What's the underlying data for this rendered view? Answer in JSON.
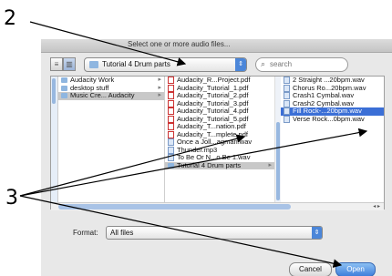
{
  "callouts": {
    "two": "2",
    "three": "3"
  },
  "dialog": {
    "title": "Select one or more audio files...",
    "folder_popup": "Tutorial 4 Drum parts",
    "search_placeholder": "search",
    "format_label": "Format:",
    "format_value": "All files",
    "cancel_label": "Cancel",
    "open_label": "Open"
  },
  "columns": {
    "col1": [
      {
        "label": "Audacity Work",
        "icon": "folder-icon"
      },
      {
        "label": "desktop stuff",
        "icon": "folder-icon"
      },
      {
        "label": "Music Cre... Audacity",
        "icon": "folder-icon"
      }
    ],
    "col2": [
      {
        "label": "Audacity_R...Project.pdf",
        "icon": "pdf-icon"
      },
      {
        "label": "Audacity_Tutorial_1.pdf",
        "icon": "pdf-icon"
      },
      {
        "label": "Audacity_Tutorial_2.pdf",
        "icon": "pdf-icon"
      },
      {
        "label": "Audacity_Tutorial_3.pdf",
        "icon": "pdf-icon"
      },
      {
        "label": "Audacity_Tutorial_4.pdf",
        "icon": "pdf-icon"
      },
      {
        "label": "Audacity_Tutorial_5.pdf",
        "icon": "pdf-icon"
      },
      {
        "label": "Audacity_T...nation.pdf",
        "icon": "pdf-icon"
      },
      {
        "label": "Audacity_T...mplete.pdf",
        "icon": "pdf-icon"
      },
      {
        "label": "Once a Joll...agman.wav",
        "icon": "audio-file-icon"
      },
      {
        "label": "Thunder.mp3",
        "icon": "audio-file-icon"
      },
      {
        "label": "To Be Or N...o Be 1.wav",
        "icon": "audio-file-icon"
      },
      {
        "label": "Tutorial 4 Drum parts",
        "icon": "folder-icon"
      }
    ],
    "col3": [
      {
        "label": "2 Straight ...20bpm.wav",
        "icon": "audio-file-icon"
      },
      {
        "label": "Chorus Ro...20bpm.wav",
        "icon": "audio-file-icon"
      },
      {
        "label": "Crash1 Cymbal.wav",
        "icon": "audio-file-icon"
      },
      {
        "label": "Crash2 Cymbal.wav",
        "icon": "audio-file-icon"
      },
      {
        "label": "Fill Rock-...20bpm.wav",
        "icon": "audio-file-icon"
      },
      {
        "label": "Verse Rock...0bpm.wav",
        "icon": "audio-file-icon"
      }
    ]
  },
  "colors": {
    "selection": "#3b6fd6",
    "accent": "#4b86d9"
  }
}
